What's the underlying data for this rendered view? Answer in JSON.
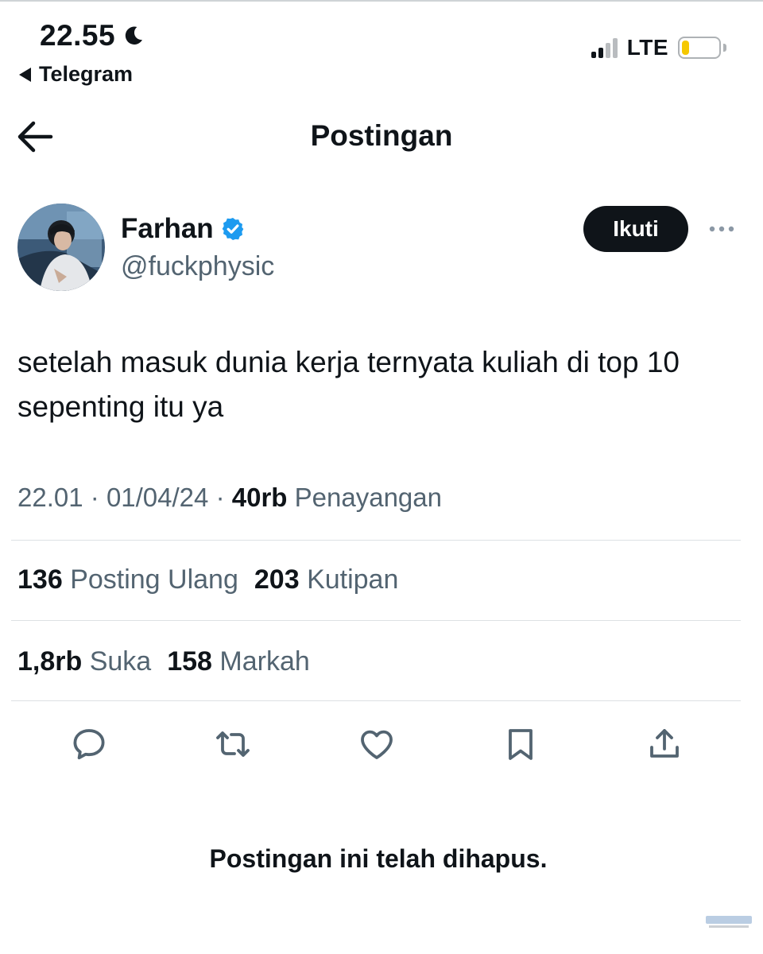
{
  "status_bar": {
    "time": "22.55",
    "back_app": "Telegram",
    "network": "LTE",
    "battery_level": 0.2,
    "battery_color": "#f5c800"
  },
  "header": {
    "title": "Postingan",
    "back_icon": "arrow-left-icon"
  },
  "post": {
    "author": {
      "name": "Farhan",
      "handle": "@fuckphysic",
      "verified": true,
      "verified_color": "#1d9bf0"
    },
    "follow_label": "Ikuti",
    "text": "setelah masuk dunia kerja ternyata kuliah di top 10 sepenting itu ya",
    "time": "22.01",
    "date": "01/04/24",
    "separator": "·",
    "views_count": "40rb",
    "views_label": "Penayangan",
    "reposts_count": "136",
    "reposts_label": "Posting Ulang",
    "quotes_count": "203",
    "quotes_label": "Kutipan",
    "likes_count": "1,8rb",
    "likes_label": "Suka",
    "bookmarks_count": "158",
    "bookmarks_label": "Markah"
  },
  "actions": [
    {
      "name": "reply",
      "icon": "reply-icon"
    },
    {
      "name": "repost",
      "icon": "repost-icon"
    },
    {
      "name": "like",
      "icon": "heart-icon"
    },
    {
      "name": "bookmark",
      "icon": "bookmark-icon"
    },
    {
      "name": "share",
      "icon": "share-icon"
    }
  ],
  "deleted_notice": "Postingan ini telah dihapus.",
  "colors": {
    "text_primary": "#0f1419",
    "text_secondary": "#536471",
    "divider": "#dde1e4"
  }
}
